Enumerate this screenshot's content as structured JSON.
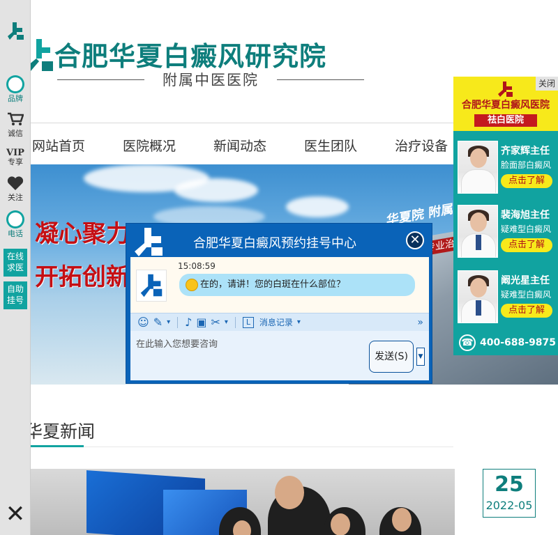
{
  "header": {
    "title": "合肥华夏白癜风研究院",
    "subtitle": "附属中医医院"
  },
  "nav": {
    "items": [
      "网站首页",
      "医院概况",
      "新闻动态",
      "医生团队",
      "治疗设备"
    ]
  },
  "banner": {
    "slogan_line1": "凝心聚力",
    "slogan_line2": "开拓创新",
    "building_sign": "华夏院 附属",
    "building_strip": "专业治疗"
  },
  "left_bar": {
    "items": [
      {
        "label": "品牌",
        "icon": "thumbs-up-icon"
      },
      {
        "label": "诚信",
        "icon": "shopping-cart-icon"
      },
      {
        "label": "专享",
        "icon": "vip-icon"
      },
      {
        "label": "关注",
        "icon": "heart-icon"
      },
      {
        "label": "电话",
        "icon": "thumbs-up-icon"
      }
    ],
    "buttons": [
      {
        "label": "在线求医"
      },
      {
        "label": "自助挂号"
      }
    ],
    "close": "✕"
  },
  "news": {
    "heading": "华夏新闻",
    "date_day": "25",
    "date_ym": "2022-05"
  },
  "right_ad": {
    "close_label": "关闭",
    "hospital": "合肥华夏白癜风医院",
    "tag": "祛白医院",
    "doctors": [
      {
        "name": "齐家辉主任",
        "dept": "脸面部白癜风",
        "cta": "点击了解"
      },
      {
        "name": "裴海旭主任",
        "dept": "疑难型白癜风",
        "cta": "点击了解"
      },
      {
        "name": "阚光星主任",
        "dept": "疑难型白癜风",
        "cta": "点击了解"
      }
    ],
    "phone": "400-688-9875"
  },
  "chat": {
    "title": "合肥华夏白癜风预约挂号中心",
    "close": "✕",
    "time": "15:08:59",
    "message": "在的，请讲！您的白斑在什么部位？",
    "history_label": "消息记录",
    "placeholder": "在此输入您想要咨询",
    "send_label": "发送(S)"
  },
  "colors": {
    "brand_teal": "#0e7e7c",
    "accent_teal": "#11a3a0",
    "chat_blue": "#0a63b8",
    "ad_yellow": "#f7e91b",
    "slogan_red": "#c40f14"
  }
}
